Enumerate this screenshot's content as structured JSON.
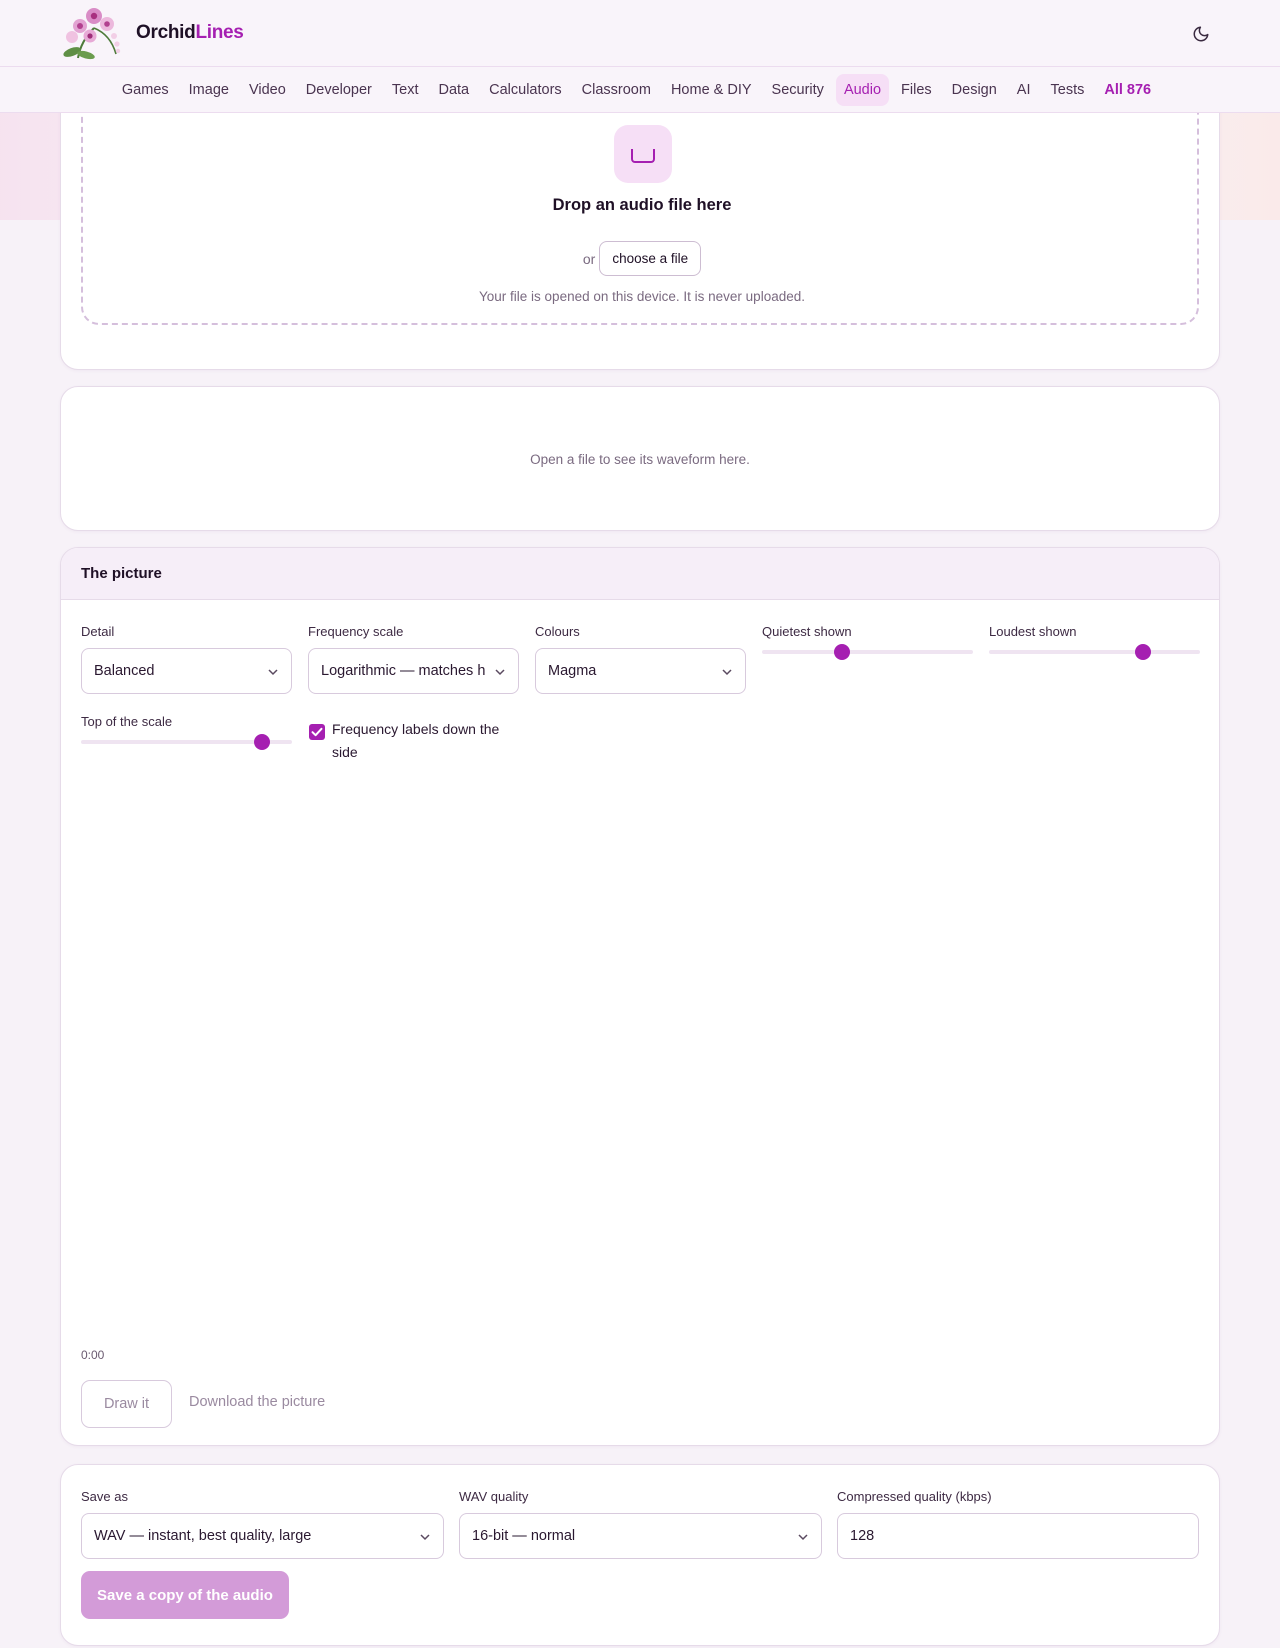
{
  "brand": {
    "name_part1": "Orchid",
    "name_part2": "Lines"
  },
  "header": {
    "theme_icon": "moon-icon"
  },
  "nav": {
    "items": [
      {
        "label": "Games"
      },
      {
        "label": "Image"
      },
      {
        "label": "Video"
      },
      {
        "label": "Developer"
      },
      {
        "label": "Text"
      },
      {
        "label": "Data"
      },
      {
        "label": "Calculators"
      },
      {
        "label": "Classroom"
      },
      {
        "label": "Home & DIY"
      },
      {
        "label": "Security"
      },
      {
        "label": "Audio",
        "active": true
      },
      {
        "label": "Files"
      },
      {
        "label": "Design"
      },
      {
        "label": "AI"
      },
      {
        "label": "Tests"
      },
      {
        "label": "All 876"
      }
    ]
  },
  "dropzone": {
    "title": "Drop an audio file here",
    "or_text": "or",
    "choose_label": "choose a file",
    "note": "Your file is opened on this device. It is never uploaded."
  },
  "waveform": {
    "placeholder": "Open a file to see its waveform here."
  },
  "picture": {
    "title": "The picture",
    "detail": {
      "label": "Detail",
      "value": "Balanced"
    },
    "frequency_scale": {
      "label": "Frequency scale",
      "value": "Logarithmic — matches h"
    },
    "colours": {
      "label": "Colours",
      "value": "Magma"
    },
    "quietest": {
      "label": "Quietest shown",
      "level": 0.38
    },
    "loudest": {
      "label": "Loudest shown",
      "level": 0.73
    },
    "top_scale": {
      "label": "Top of the scale",
      "level": 0.86
    },
    "freq_labels": {
      "label": "Frequency labels down the side",
      "checked": true
    },
    "time_start": "0:00",
    "draw_label": "Draw it",
    "download_label": "Download the picture"
  },
  "save": {
    "format": {
      "label": "Save as",
      "value": "WAV — instant, best quality, large"
    },
    "wav_quality": {
      "label": "WAV quality",
      "value": "16-bit — normal"
    },
    "compressed": {
      "label": "Compressed quality (kbps)",
      "value": "128"
    },
    "button_label": "Save a copy of the audio"
  },
  "colors": {
    "accent": "#a51fb1",
    "accent_soft": "#f6dff6",
    "disabled_button": "#d39bd8"
  }
}
